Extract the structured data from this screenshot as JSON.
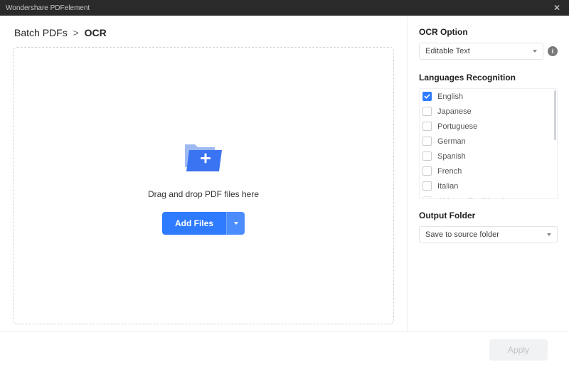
{
  "titlebar": {
    "app_name": "Wondershare PDFelement"
  },
  "breadcrumb": {
    "parent": "Batch PDFs",
    "separator": ">",
    "current": "OCR"
  },
  "dropzone": {
    "hint": "Drag and drop PDF files here",
    "add_label": "Add Files"
  },
  "ocr": {
    "section_title": "OCR Option",
    "selected": "Editable Text"
  },
  "languages": {
    "section_title": "Languages Recognition",
    "items": [
      {
        "label": "English",
        "checked": true
      },
      {
        "label": "Japanese",
        "checked": false
      },
      {
        "label": "Portuguese",
        "checked": false
      },
      {
        "label": "German",
        "checked": false
      },
      {
        "label": "Spanish",
        "checked": false
      },
      {
        "label": "French",
        "checked": false
      },
      {
        "label": "Italian",
        "checked": false
      },
      {
        "label": "Chinese Traditional",
        "checked": false
      }
    ]
  },
  "output": {
    "section_title": "Output Folder",
    "selected": "Save to source folder"
  },
  "footer": {
    "apply_label": "Apply"
  }
}
